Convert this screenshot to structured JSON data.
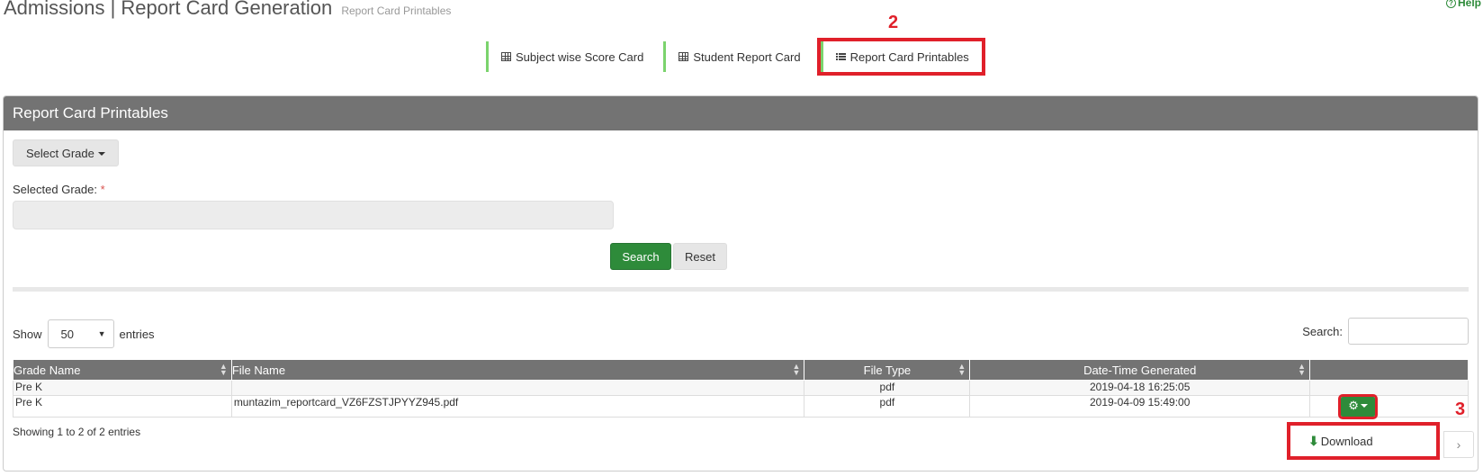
{
  "header": {
    "title": "Admissions | Report Card Generation",
    "subtitle": "Report Card Printables",
    "help": "Help"
  },
  "annotations": {
    "step2": "2",
    "step3": "3"
  },
  "tabs": [
    {
      "label": "Subject wise Score Card",
      "icon": "grid-icon"
    },
    {
      "label": "Student Report Card",
      "icon": "grid-icon"
    },
    {
      "label": "Report Card Printables",
      "icon": "list-icon"
    }
  ],
  "panel": {
    "title": "Report Card Printables",
    "select_grade_label": "Select Grade",
    "selected_grade_label": "Selected Grade:",
    "required_mark": "*",
    "selected_grade_value": "",
    "search_label": "Search",
    "reset_label": "Reset"
  },
  "table_controls": {
    "show_label": "Show",
    "entries_value": "50",
    "entries_label": "entries",
    "search_label": "Search:"
  },
  "table": {
    "columns": [
      "Grade Name",
      "File Name",
      "File Type",
      "Date-Time Generated",
      ""
    ],
    "rows": [
      {
        "grade": "Pre K",
        "file": "",
        "type": "pdf",
        "generated": "2019-04-18 16:25:05"
      },
      {
        "grade": "Pre K",
        "file": "muntazim_reportcard_VZ6FZSTJPYYZ945.pdf",
        "type": "pdf",
        "generated": "2019-04-09 15:49:00"
      }
    ]
  },
  "footer": {
    "info": "Showing 1 to 2 of 2 entries",
    "download_label": "Download"
  },
  "colors": {
    "accent_green": "#2e8b3a",
    "header_gray": "#737373",
    "annotation_red": "#e0202a",
    "tab_border_green": "#7bd36d"
  }
}
